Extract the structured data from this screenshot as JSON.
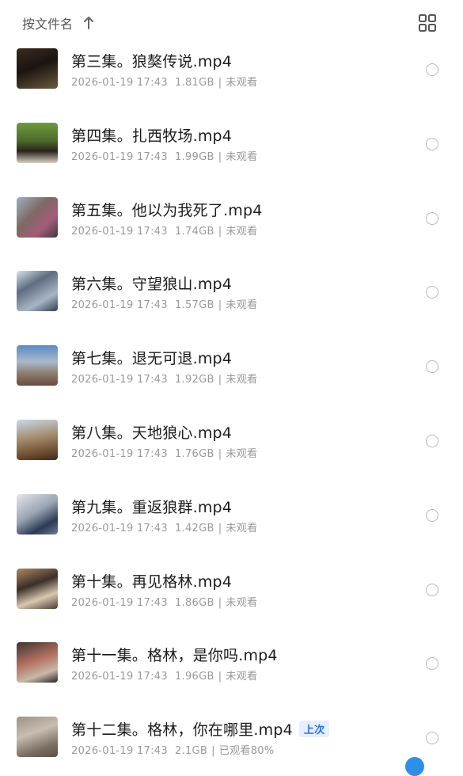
{
  "header": {
    "sort_label": "按文件名",
    "sort_icon": "arrow-up-icon",
    "view_icon": "grid-view-icon"
  },
  "files": [
    {
      "title": "第三集。狼獒传说.mp4",
      "date": "2026-01-19 17:43",
      "size": "1.81GB",
      "status": "未观看"
    },
    {
      "title": "第四集。扎西牧场.mp4",
      "date": "2026-01-19 17:43",
      "size": "1.99GB",
      "status": "未观看"
    },
    {
      "title": "第五集。他以为我死了.mp4",
      "date": "2026-01-19 17:43",
      "size": "1.74GB",
      "status": "未观看"
    },
    {
      "title": "第六集。守望狼山.mp4",
      "date": "2026-01-19 17:43",
      "size": "1.57GB",
      "status": "未观看"
    },
    {
      "title": "第七集。退无可退.mp4",
      "date": "2026-01-19 17:43",
      "size": "1.92GB",
      "status": "未观看"
    },
    {
      "title": "第八集。天地狼心.mp4",
      "date": "2026-01-19 17:43",
      "size": "1.76GB",
      "status": "未观看"
    },
    {
      "title": "第九集。重返狼群.mp4",
      "date": "2026-01-19 17:43",
      "size": "1.42GB",
      "status": "未观看"
    },
    {
      "title": "第十集。再见格林.mp4",
      "date": "2026-01-19 17:43",
      "size": "1.86GB",
      "status": "未观看"
    },
    {
      "title": "第十一集。格林，是你吗.mp4",
      "date": "2026-01-19 17:43",
      "size": "1.96GB",
      "status": "未观看"
    },
    {
      "title": "第十二集。格林，你在哪里.mp4",
      "date": "2026-01-19 17:43",
      "size": "2.1GB",
      "status": "已观看80%",
      "badge": "上次"
    }
  ],
  "meta_separator": "|",
  "colors": {
    "accent": "#2f6fe0",
    "badge_bg": "#e6efff",
    "meta_text": "#9a9a9a"
  }
}
